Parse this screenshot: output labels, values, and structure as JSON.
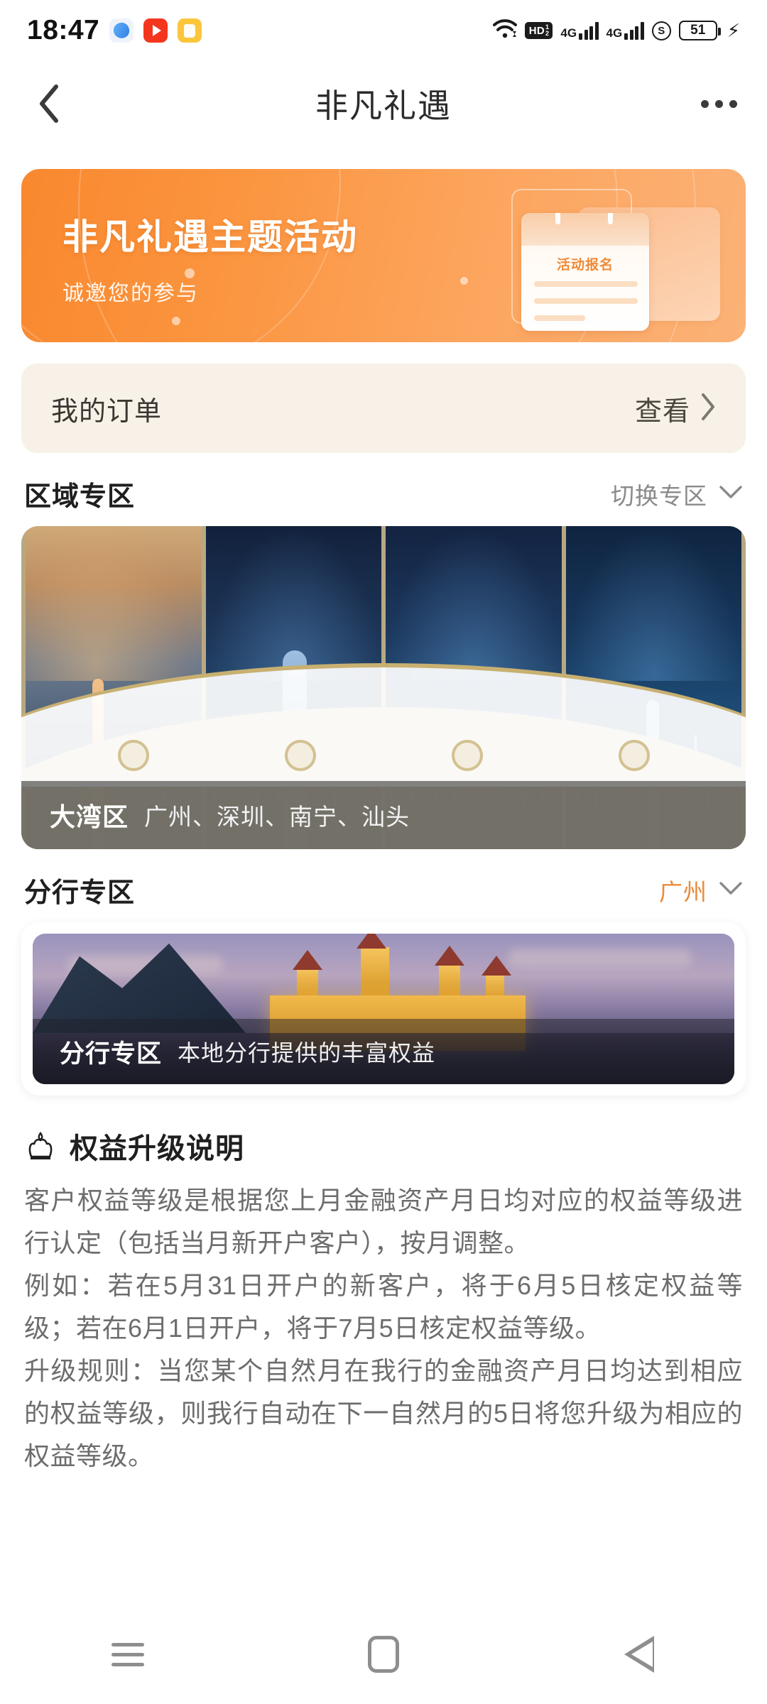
{
  "status_bar": {
    "time": "18:47",
    "app_icons": [
      "messenger-icon",
      "video-player-icon",
      "notes-icon"
    ],
    "wifi": "wifi-icon",
    "hd_label": "HD",
    "hd_sup": "1",
    "hd_sub": "2",
    "signal_1_label": "4G",
    "signal_2_label": "4G",
    "security_label": "S",
    "battery_level": "51",
    "charging": "⚡"
  },
  "header": {
    "back": "back-arrow",
    "title": "非凡礼遇",
    "more": "more-options"
  },
  "banner": {
    "title": "非凡礼遇主题活动",
    "subtitle": "诚邀您的参与",
    "clipboard_label": "活动报名",
    "accent_color": "#f9882e"
  },
  "order_card": {
    "title": "我的订单",
    "action": "查看",
    "chevron": "chevron-right-icon",
    "bg_color": "#f7f1e7"
  },
  "region_section": {
    "title": "区域专区",
    "action": "切换专区",
    "chevron": "chevron-down-icon",
    "card": {
      "name": "大湾区",
      "cities": "广州、深圳、南宁、汕头"
    }
  },
  "branch_section": {
    "title": "分行专区",
    "selected_city": "广州",
    "chevron": "chevron-down-icon",
    "accent_color": "#e98c3b",
    "card": {
      "name": "分行专区",
      "description": "本地分行提供的丰富权益"
    }
  },
  "explanation": {
    "icon": "crown-icon",
    "title": "权益升级说明",
    "paragraphs": [
      "客户权益等级是根据您上月金融资产月日均对应的权益等级进行认定（包括当月新开户客户），按月调整。",
      "例如：若在5月31日开户的新客户，将于6月5日核定权益等级；若在6月1日开户，将于7月5日核定权益等级。",
      "升级规则：当您某个自然月在我行的金融资产月日均达到相应的权益等级，则我行自动在下一自然月的5日将您升级为相应的权益等级。"
    ]
  },
  "navbar": {
    "recents": "menu-icon",
    "home": "home-icon",
    "back": "back-triangle-icon"
  }
}
